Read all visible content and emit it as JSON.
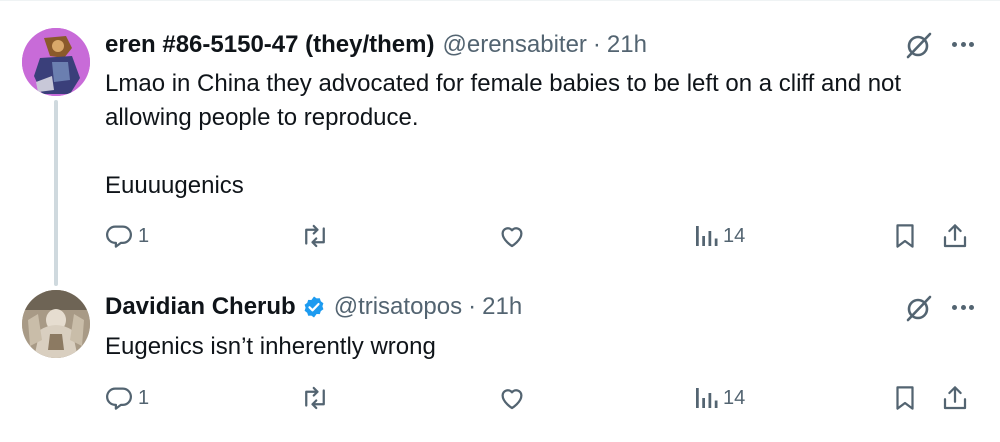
{
  "tweets": [
    {
      "author_name": "eren #86-5150-47 (they/them)",
      "handle": "@erensabiter",
      "separator": "·",
      "time": "21h",
      "text_lines": [
        "Lmao in China they advocated for female babies to be left on a cliff and not allowing people to reproduce.",
        "Euuuugenics"
      ],
      "reply_count": "1",
      "retweet_count": "",
      "like_count": "",
      "view_count": "14",
      "verified": false
    },
    {
      "author_name": "Davidian Cherub",
      "handle": "@trisatopos",
      "separator": "·",
      "time": "21h",
      "text_lines": [
        "Eugenics isn’t inherently wrong"
      ],
      "reply_count": "1",
      "retweet_count": "",
      "like_count": "",
      "view_count": "14",
      "verified": true
    }
  ],
  "colors": {
    "text": "#0f1419",
    "secondary": "#536471",
    "verified_badge": "#1d9bf0",
    "avatar1_bg": "#c86bd8",
    "thread_line": "#cfd9de"
  },
  "icons": [
    "reply-icon",
    "retweet-icon",
    "like-icon",
    "views-icon",
    "bookmark-icon",
    "share-icon",
    "grok-icon",
    "more-icon",
    "verified-badge-icon"
  ]
}
